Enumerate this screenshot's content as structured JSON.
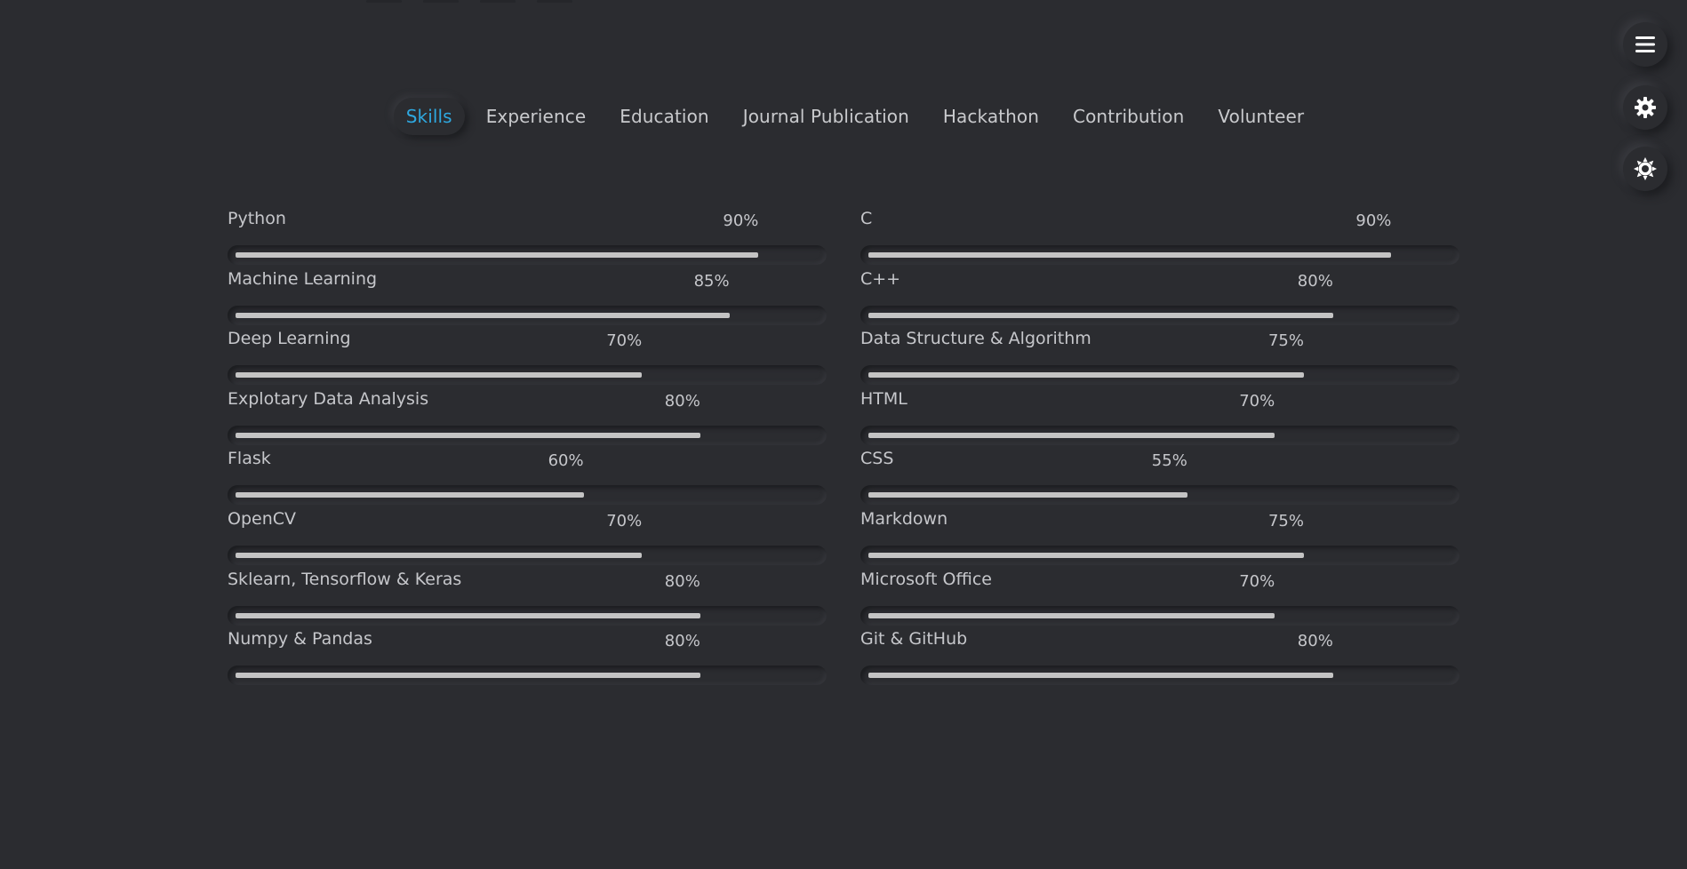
{
  "tabs": [
    {
      "label": "Skills",
      "active": true
    },
    {
      "label": "Experience",
      "active": false
    },
    {
      "label": "Education",
      "active": false
    },
    {
      "label": "Journal Publication",
      "active": false
    },
    {
      "label": "Hackathon",
      "active": false
    },
    {
      "label": "Contribution",
      "active": false
    },
    {
      "label": "Volunteer",
      "active": false
    }
  ],
  "floating_buttons": [
    {
      "icon": "menu-icon"
    },
    {
      "icon": "gear-icon"
    },
    {
      "icon": "theme-sun-icon"
    }
  ],
  "colors": {
    "background": "#2b2c30",
    "accent": "#2ea8e0",
    "bar_fill": "#c4c4c4",
    "text": "#c6c7cb"
  },
  "skills_left": [
    {
      "name": "Python",
      "percent_label": "90%",
      "value": 90
    },
    {
      "name": "Machine Learning",
      "percent_label": "85%",
      "value": 85
    },
    {
      "name": "Deep Learning",
      "percent_label": "70%",
      "value": 70
    },
    {
      "name": "Explotary Data Analysis",
      "percent_label": "80%",
      "value": 80
    },
    {
      "name": "Flask",
      "percent_label": "60%",
      "value": 60
    },
    {
      "name": "OpenCV",
      "percent_label": "70%",
      "value": 70
    },
    {
      "name": "Sklearn, Tensorflow & Keras",
      "percent_label": "80%",
      "value": 80
    },
    {
      "name": "Numpy & Pandas",
      "percent_label": "80%",
      "value": 80
    }
  ],
  "skills_right": [
    {
      "name": "C",
      "percent_label": "90%",
      "value": 90
    },
    {
      "name": "C++",
      "percent_label": "80%",
      "value": 80
    },
    {
      "name": "Data Structure & Algorithm",
      "percent_label": "75%",
      "value": 75
    },
    {
      "name": "HTML",
      "percent_label": "70%",
      "value": 70
    },
    {
      "name": "CSS",
      "percent_label": "55%",
      "value": 55
    },
    {
      "name": "Markdown",
      "percent_label": "75%",
      "value": 75
    },
    {
      "name": "Microsoft Office",
      "percent_label": "70%",
      "value": 70
    },
    {
      "name": "Git & GitHub",
      "percent_label": "80%",
      "value": 80
    }
  ]
}
